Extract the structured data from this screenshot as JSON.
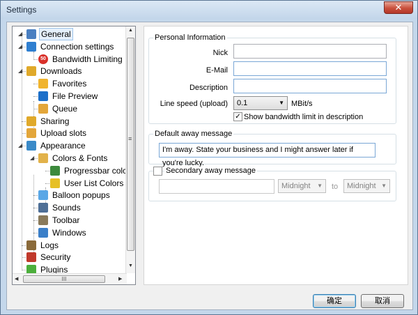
{
  "window": {
    "title": "Settings",
    "close_glyph": "✕"
  },
  "tree": {
    "items": [
      {
        "label": "General",
        "icon": "user-icon",
        "color": "#4a7fc1"
      },
      {
        "label": "Connection settings",
        "icon": "globe-icon",
        "color": "#2f7fd0"
      },
      {
        "label": "Bandwidth Limiting",
        "icon": "speed-limit-icon",
        "color": "#d9302a",
        "icon_text": "50"
      },
      {
        "label": "Downloads",
        "icon": "downloads-icon",
        "color": "#e0a92a"
      },
      {
        "label": "Favorites",
        "icon": "favorites-icon",
        "color": "#f0b42e"
      },
      {
        "label": "File Preview",
        "icon": "preview-icon",
        "color": "#1c6fc9"
      },
      {
        "label": "Queue",
        "icon": "queue-icon",
        "color": "#e3a63a"
      },
      {
        "label": "Sharing",
        "icon": "sharing-icon",
        "color": "#e0a92a"
      },
      {
        "label": "Upload slots",
        "icon": "upload-icon",
        "color": "#e3a63a"
      },
      {
        "label": "Appearance",
        "icon": "appearance-icon",
        "color": "#3a8ac8"
      },
      {
        "label": "Colors & Fonts",
        "icon": "palette-icon",
        "color": "#e2b24a"
      },
      {
        "label": "Progressbar colc",
        "icon": "progressbar-icon",
        "color": "#3c8a3c"
      },
      {
        "label": "User List Colors",
        "icon": "userlist-icon",
        "color": "#e6c026"
      },
      {
        "label": "Balloon popups",
        "icon": "balloon-icon",
        "color": "#5aa7e6"
      },
      {
        "label": "Sounds",
        "icon": "sounds-icon",
        "color": "#4e6f96"
      },
      {
        "label": "Toolbar",
        "icon": "toolbar-icon",
        "color": "#8a7a5a"
      },
      {
        "label": "Windows",
        "icon": "windows-icon",
        "color": "#3b7fc8"
      },
      {
        "label": "Logs",
        "icon": "logs-icon",
        "color": "#8a6a3a"
      },
      {
        "label": "Security",
        "icon": "security-icon",
        "color": "#c0392b"
      },
      {
        "label": "Plugins",
        "icon": "plugins-icon",
        "color": "#4caf3c"
      }
    ],
    "grip_glyph": "≡",
    "hscroll_glyph": "III",
    "arrow_up": "▲",
    "arrow_down": "▼",
    "arrow_left": "◀",
    "arrow_right": "▶",
    "expander_glyph": "◢"
  },
  "personal": {
    "legend": "Personal Information",
    "nick_label": "Nick",
    "nick_value": "",
    "email_label": "E-Mail",
    "email_value": "",
    "description_label": "Description",
    "description_value": "",
    "line_speed_label": "Line speed (upload)",
    "line_speed_value": "0.1",
    "line_speed_unit": "MBit/s",
    "show_bw_label": "Show bandwidth limit in description",
    "show_bw_checked": "✓"
  },
  "away": {
    "legend": "Default away message",
    "message": "I'm away. State your business and I might answer later if you're lucky."
  },
  "secondary": {
    "legend": "Secondary away message",
    "message": "",
    "from": "Midnight",
    "to_label": "to",
    "to": "Midnight"
  },
  "buttons": {
    "ok": "确定",
    "cancel": "取消"
  }
}
